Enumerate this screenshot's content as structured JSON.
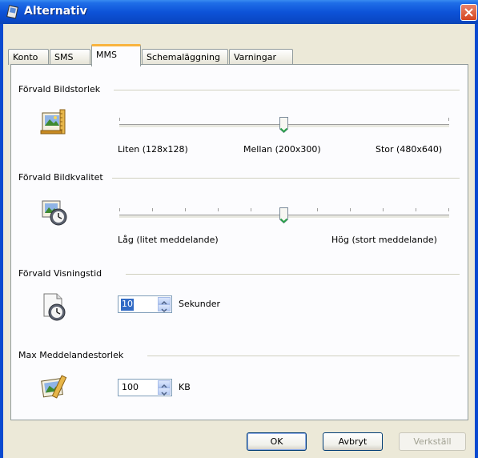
{
  "window": {
    "title": "Alternativ"
  },
  "tabs": [
    {
      "label": "Konto"
    },
    {
      "label": "SMS"
    },
    {
      "label": "MMS"
    },
    {
      "label": "Schemaläggning"
    },
    {
      "label": "Varningar"
    }
  ],
  "active_tab": "MMS",
  "image_size": {
    "heading": "Förvald Bildstorlek",
    "min_label": "Liten (128x128)",
    "mid_label": "Mellan (200x300)",
    "max_label": "Stor (480x640)",
    "position_fraction": 0.5,
    "steps": 3
  },
  "image_quality": {
    "heading": "Förvald Bildkvalitet",
    "min_label": "Låg (litet meddelande)",
    "max_label": "Hög (stort meddelande)",
    "position_fraction": 0.5,
    "steps": 11
  },
  "display_time": {
    "heading": "Förvald Visningstid",
    "value": "10",
    "unit": "Sekunder"
  },
  "max_size": {
    "heading": "Max Meddelandestorlek",
    "value": "100",
    "unit": "KB"
  },
  "buttons": {
    "ok": "OK",
    "cancel": "Avbryt",
    "apply": "Verkställ"
  },
  "icons": {
    "title": "app-icon",
    "close": "close-icon",
    "image_size": "picture-ruler-icon",
    "image_quality": "picture-clock-icon",
    "display_time": "document-clock-icon",
    "max_size": "picture-ruler-icon"
  },
  "colors": {
    "titlebar": "#0a48c6",
    "tab_highlight": "#f9b43e",
    "slider_thumb": "#2aa14a",
    "selection": "#316ac5"
  }
}
